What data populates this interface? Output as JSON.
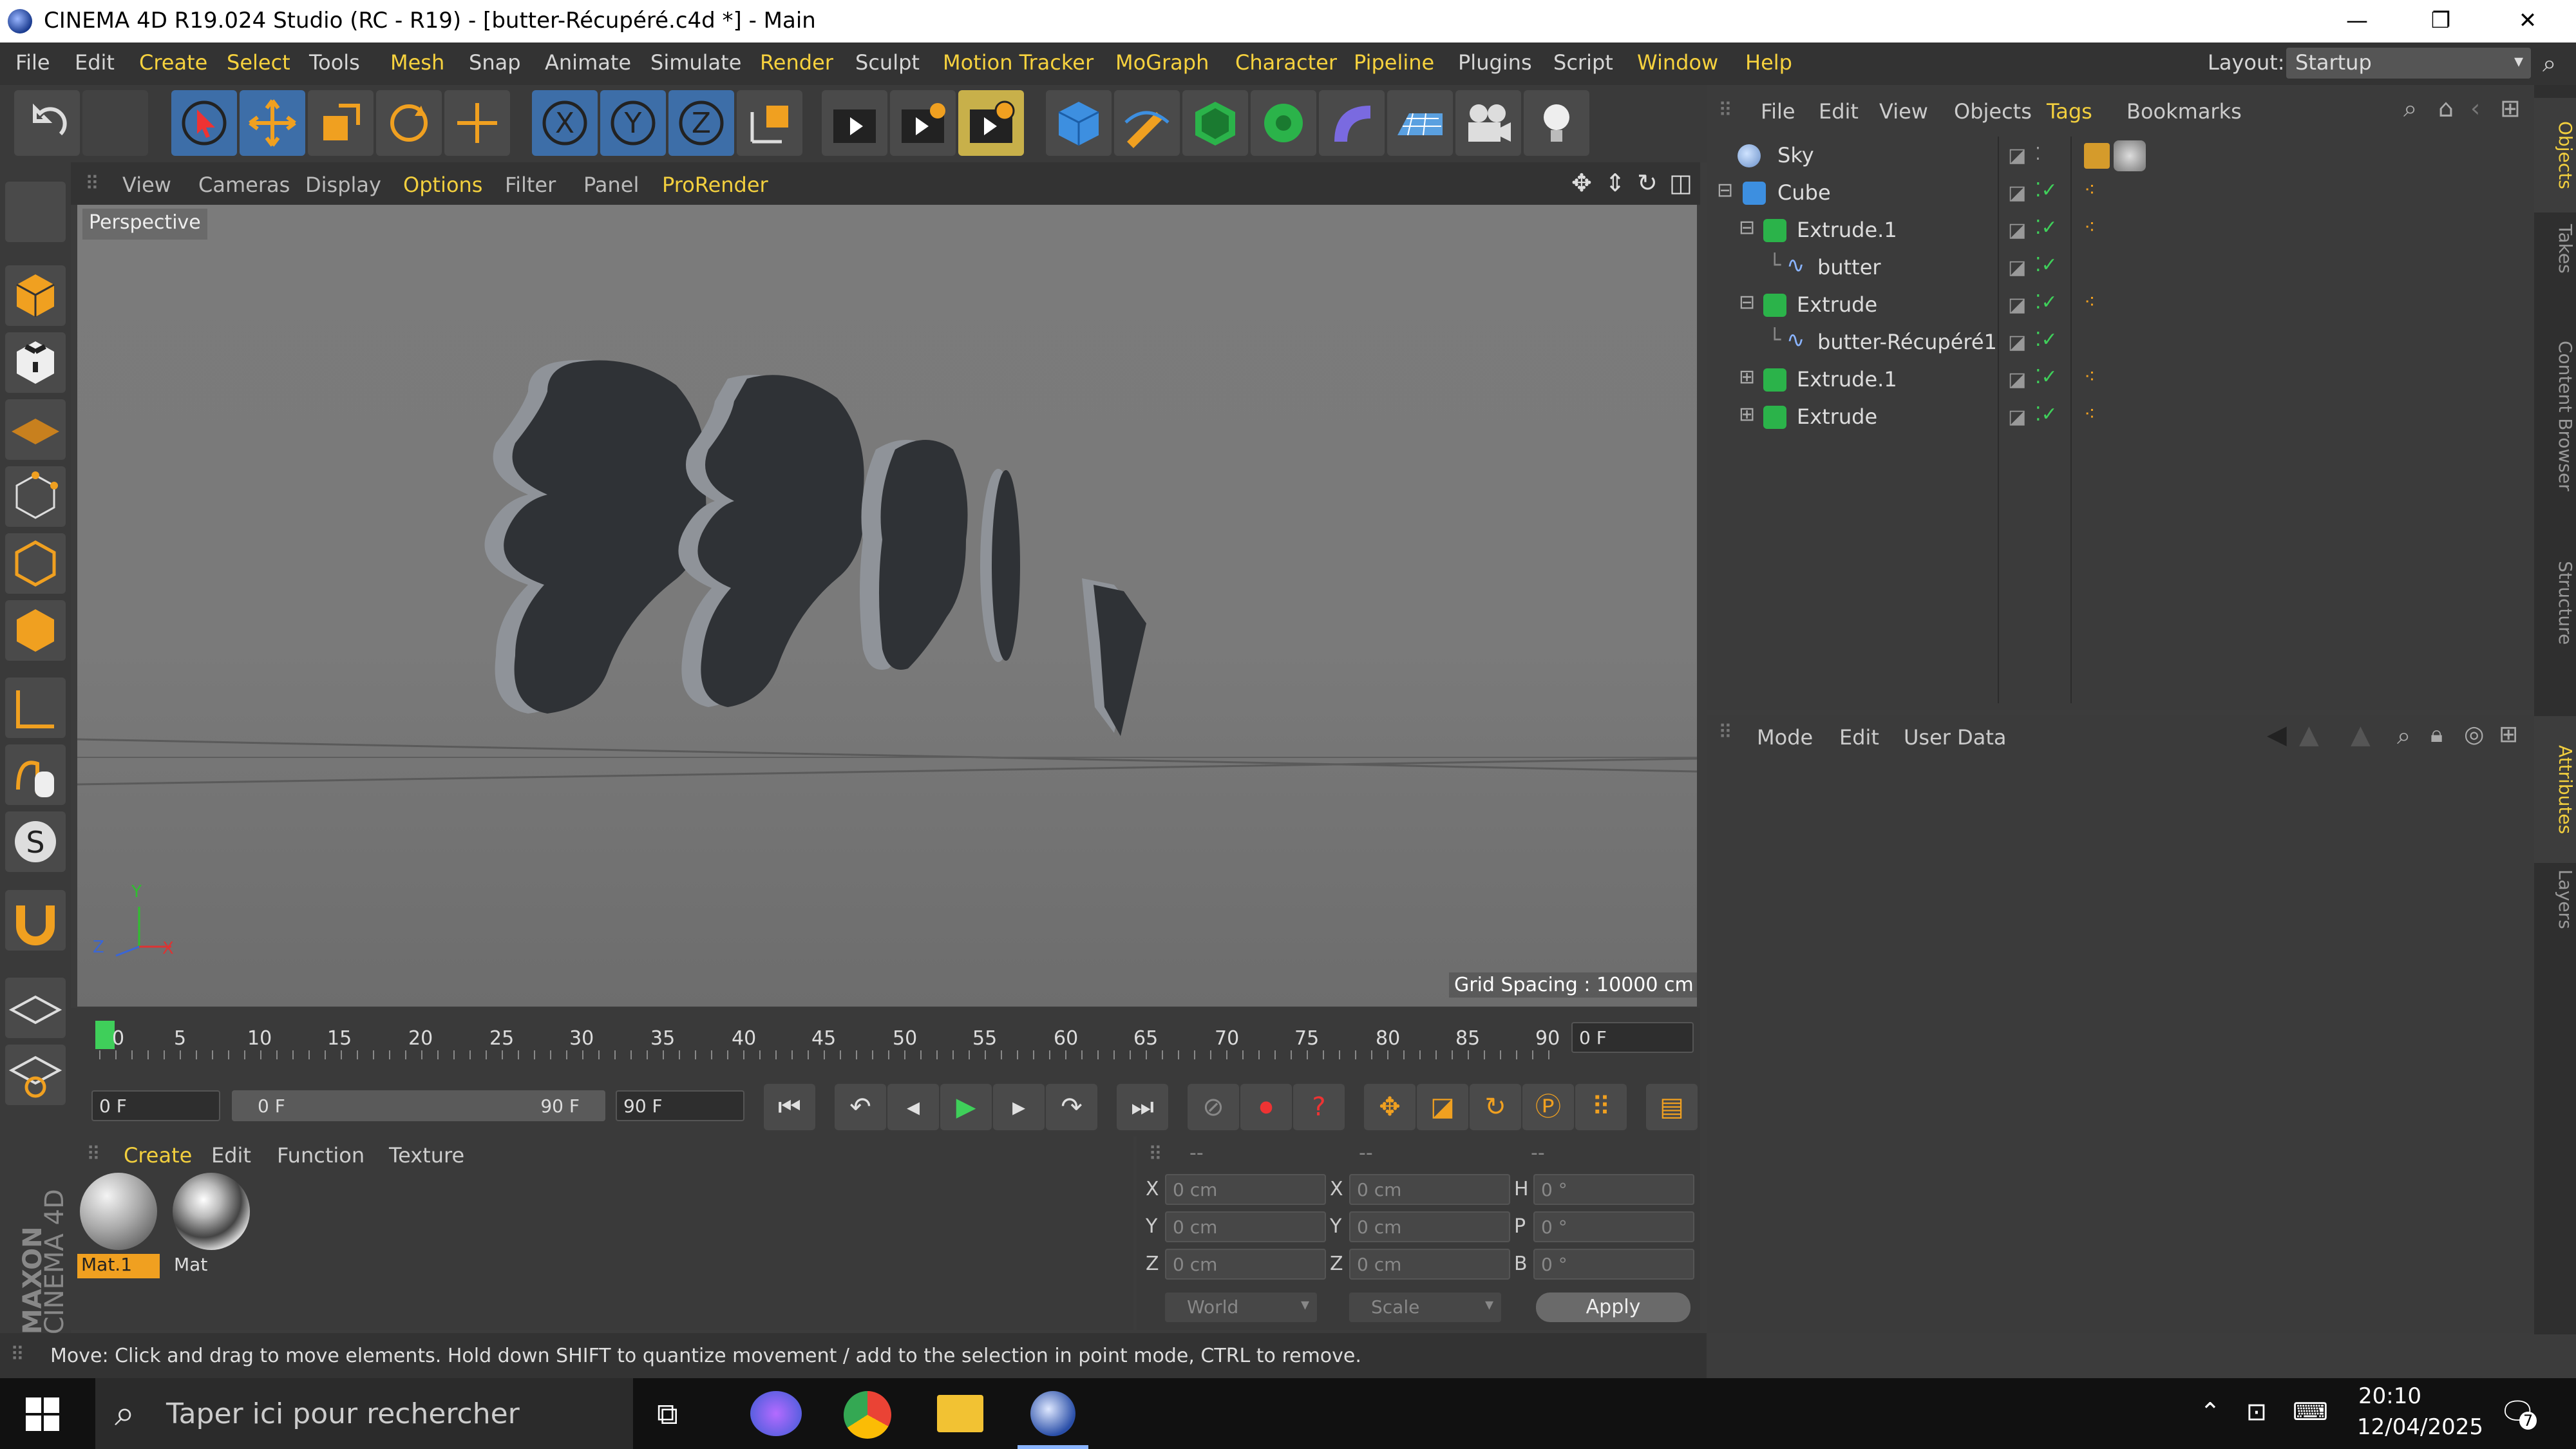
{
  "window": {
    "title": "CINEMA 4D R19.024 Studio (RC - R19) - [butter-Récupéré.c4d *] - Main",
    "minimize": "—",
    "maximize": "❐",
    "close": "✕"
  },
  "menubar": {
    "items": [
      "File",
      "Edit",
      "Create",
      "Select",
      "Tools",
      "Mesh",
      "Snap",
      "Animate",
      "Simulate",
      "Render",
      "Sculpt",
      "Motion Tracker",
      "MoGraph",
      "Character",
      "Pipeline",
      "Plugins",
      "Script",
      "Window",
      "Help"
    ],
    "layout_label": "Layout:",
    "layout_value": "Startup"
  },
  "viewport": {
    "menu": [
      "View",
      "Cameras",
      "Display",
      "Options",
      "Filter",
      "Panel",
      "ProRender"
    ],
    "label": "Perspective",
    "grid_spacing": "Grid Spacing : 10000 cm",
    "axis_y": "Y",
    "axis_x": "X",
    "axis_z": "Z"
  },
  "timeline": {
    "ticks": [
      "0",
      "5",
      "10",
      "15",
      "20",
      "25",
      "30",
      "35",
      "40",
      "45",
      "50",
      "55",
      "60",
      "65",
      "70",
      "75",
      "80",
      "85",
      "90"
    ],
    "current_frame": "0 F",
    "start_field": "0 F",
    "range_start": "0 F",
    "range_end": "90 F",
    "end_field": "90 F"
  },
  "material_manager": {
    "menu": [
      "Create",
      "Edit",
      "Function",
      "Texture"
    ],
    "materials": [
      {
        "name": "Mat.1",
        "selected": true
      },
      {
        "name": "Mat",
        "selected": false
      }
    ]
  },
  "coordinates": {
    "headers": [
      "--",
      "--",
      "--"
    ],
    "rows": [
      {
        "l1": "X",
        "v1": "0 cm",
        "l2": "X",
        "v2": "0 cm",
        "l3": "H",
        "v3": "0 °"
      },
      {
        "l1": "Y",
        "v1": "0 cm",
        "l2": "Y",
        "v2": "0 cm",
        "l3": "P",
        "v3": "0 °"
      },
      {
        "l1": "Z",
        "v1": "0 cm",
        "l2": "Z",
        "v2": "0 cm",
        "l3": "B",
        "v3": "0 °"
      }
    ],
    "mode": "World",
    "scale": "Scale",
    "apply": "Apply"
  },
  "status": "Move: Click and drag to move elements. Hold down SHIFT to quantize movement / add to the selection in point mode, CTRL to remove.",
  "object_manager": {
    "menu": [
      "File",
      "Edit",
      "View",
      "Objects",
      "Tags",
      "Bookmarks"
    ],
    "objects": [
      {
        "name": "Sky",
        "indent": 0,
        "type": "sky"
      },
      {
        "name": "Cube",
        "indent": 0,
        "type": "cube"
      },
      {
        "name": "Extrude.1",
        "indent": 1,
        "type": "extrude"
      },
      {
        "name": "butter",
        "indent": 2,
        "type": "spline"
      },
      {
        "name": "Extrude",
        "indent": 1,
        "type": "extrude"
      },
      {
        "name": "butter-Récupéré1",
        "indent": 2,
        "type": "spline"
      },
      {
        "name": "Extrude.1",
        "indent": 1,
        "type": "extrude"
      },
      {
        "name": "Extrude",
        "indent": 1,
        "type": "extrude"
      }
    ]
  },
  "attribute_manager": {
    "menu": [
      "Mode",
      "Edit",
      "User Data"
    ]
  },
  "right_tabs": [
    "Objects",
    "Takes",
    "Content Browser",
    "Structure",
    "Attributes",
    "Layers"
  ],
  "taskbar": {
    "search_placeholder": "Taper ici pour rechercher",
    "time": "20:10",
    "date": "12/04/2025",
    "notification_count": "7"
  },
  "colors": {
    "accent": "#f2cf3e",
    "toolbar_blue": "#3d6ea8",
    "viewport_bg": "#7a7a7a"
  }
}
